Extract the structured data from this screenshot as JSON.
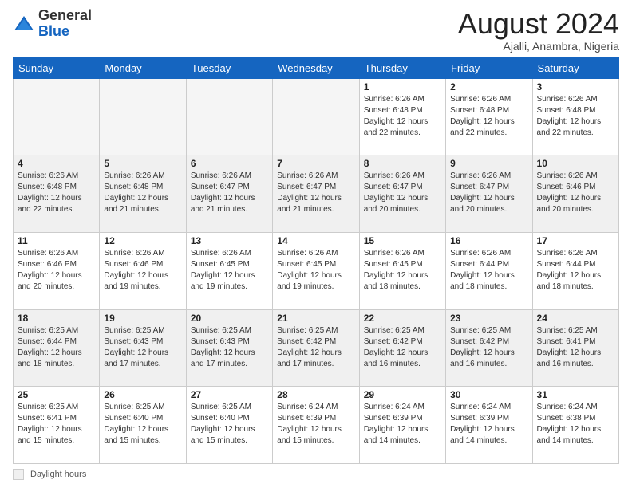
{
  "header": {
    "logo_general": "General",
    "logo_blue": "Blue",
    "month_title": "August 2024",
    "subtitle": "Ajalli, Anambra, Nigeria"
  },
  "days_of_week": [
    "Sunday",
    "Monday",
    "Tuesday",
    "Wednesday",
    "Thursday",
    "Friday",
    "Saturday"
  ],
  "weeks": [
    [
      {
        "day": "",
        "info": "",
        "empty": true
      },
      {
        "day": "",
        "info": "",
        "empty": true
      },
      {
        "day": "",
        "info": "",
        "empty": true
      },
      {
        "day": "",
        "info": "",
        "empty": true
      },
      {
        "day": "1",
        "info": "Sunrise: 6:26 AM\nSunset: 6:48 PM\nDaylight: 12 hours\nand 22 minutes."
      },
      {
        "day": "2",
        "info": "Sunrise: 6:26 AM\nSunset: 6:48 PM\nDaylight: 12 hours\nand 22 minutes."
      },
      {
        "day": "3",
        "info": "Sunrise: 6:26 AM\nSunset: 6:48 PM\nDaylight: 12 hours\nand 22 minutes."
      }
    ],
    [
      {
        "day": "4",
        "info": "Sunrise: 6:26 AM\nSunset: 6:48 PM\nDaylight: 12 hours\nand 22 minutes.",
        "shaded": true
      },
      {
        "day": "5",
        "info": "Sunrise: 6:26 AM\nSunset: 6:48 PM\nDaylight: 12 hours\nand 21 minutes.",
        "shaded": true
      },
      {
        "day": "6",
        "info": "Sunrise: 6:26 AM\nSunset: 6:47 PM\nDaylight: 12 hours\nand 21 minutes.",
        "shaded": true
      },
      {
        "day": "7",
        "info": "Sunrise: 6:26 AM\nSunset: 6:47 PM\nDaylight: 12 hours\nand 21 minutes.",
        "shaded": true
      },
      {
        "day": "8",
        "info": "Sunrise: 6:26 AM\nSunset: 6:47 PM\nDaylight: 12 hours\nand 20 minutes.",
        "shaded": true
      },
      {
        "day": "9",
        "info": "Sunrise: 6:26 AM\nSunset: 6:47 PM\nDaylight: 12 hours\nand 20 minutes.",
        "shaded": true
      },
      {
        "day": "10",
        "info": "Sunrise: 6:26 AM\nSunset: 6:46 PM\nDaylight: 12 hours\nand 20 minutes.",
        "shaded": true
      }
    ],
    [
      {
        "day": "11",
        "info": "Sunrise: 6:26 AM\nSunset: 6:46 PM\nDaylight: 12 hours\nand 20 minutes."
      },
      {
        "day": "12",
        "info": "Sunrise: 6:26 AM\nSunset: 6:46 PM\nDaylight: 12 hours\nand 19 minutes."
      },
      {
        "day": "13",
        "info": "Sunrise: 6:26 AM\nSunset: 6:45 PM\nDaylight: 12 hours\nand 19 minutes."
      },
      {
        "day": "14",
        "info": "Sunrise: 6:26 AM\nSunset: 6:45 PM\nDaylight: 12 hours\nand 19 minutes."
      },
      {
        "day": "15",
        "info": "Sunrise: 6:26 AM\nSunset: 6:45 PM\nDaylight: 12 hours\nand 18 minutes."
      },
      {
        "day": "16",
        "info": "Sunrise: 6:26 AM\nSunset: 6:44 PM\nDaylight: 12 hours\nand 18 minutes."
      },
      {
        "day": "17",
        "info": "Sunrise: 6:26 AM\nSunset: 6:44 PM\nDaylight: 12 hours\nand 18 minutes."
      }
    ],
    [
      {
        "day": "18",
        "info": "Sunrise: 6:25 AM\nSunset: 6:44 PM\nDaylight: 12 hours\nand 18 minutes.",
        "shaded": true
      },
      {
        "day": "19",
        "info": "Sunrise: 6:25 AM\nSunset: 6:43 PM\nDaylight: 12 hours\nand 17 minutes.",
        "shaded": true
      },
      {
        "day": "20",
        "info": "Sunrise: 6:25 AM\nSunset: 6:43 PM\nDaylight: 12 hours\nand 17 minutes.",
        "shaded": true
      },
      {
        "day": "21",
        "info": "Sunrise: 6:25 AM\nSunset: 6:42 PM\nDaylight: 12 hours\nand 17 minutes.",
        "shaded": true
      },
      {
        "day": "22",
        "info": "Sunrise: 6:25 AM\nSunset: 6:42 PM\nDaylight: 12 hours\nand 16 minutes.",
        "shaded": true
      },
      {
        "day": "23",
        "info": "Sunrise: 6:25 AM\nSunset: 6:42 PM\nDaylight: 12 hours\nand 16 minutes.",
        "shaded": true
      },
      {
        "day": "24",
        "info": "Sunrise: 6:25 AM\nSunset: 6:41 PM\nDaylight: 12 hours\nand 16 minutes.",
        "shaded": true
      }
    ],
    [
      {
        "day": "25",
        "info": "Sunrise: 6:25 AM\nSunset: 6:41 PM\nDaylight: 12 hours\nand 15 minutes."
      },
      {
        "day": "26",
        "info": "Sunrise: 6:25 AM\nSunset: 6:40 PM\nDaylight: 12 hours\nand 15 minutes."
      },
      {
        "day": "27",
        "info": "Sunrise: 6:25 AM\nSunset: 6:40 PM\nDaylight: 12 hours\nand 15 minutes."
      },
      {
        "day": "28",
        "info": "Sunrise: 6:24 AM\nSunset: 6:39 PM\nDaylight: 12 hours\nand 15 minutes."
      },
      {
        "day": "29",
        "info": "Sunrise: 6:24 AM\nSunset: 6:39 PM\nDaylight: 12 hours\nand 14 minutes."
      },
      {
        "day": "30",
        "info": "Sunrise: 6:24 AM\nSunset: 6:39 PM\nDaylight: 12 hours\nand 14 minutes."
      },
      {
        "day": "31",
        "info": "Sunrise: 6:24 AM\nSunset: 6:38 PM\nDaylight: 12 hours\nand 14 minutes."
      }
    ]
  ],
  "footer": {
    "legend_label": "Daylight hours"
  }
}
